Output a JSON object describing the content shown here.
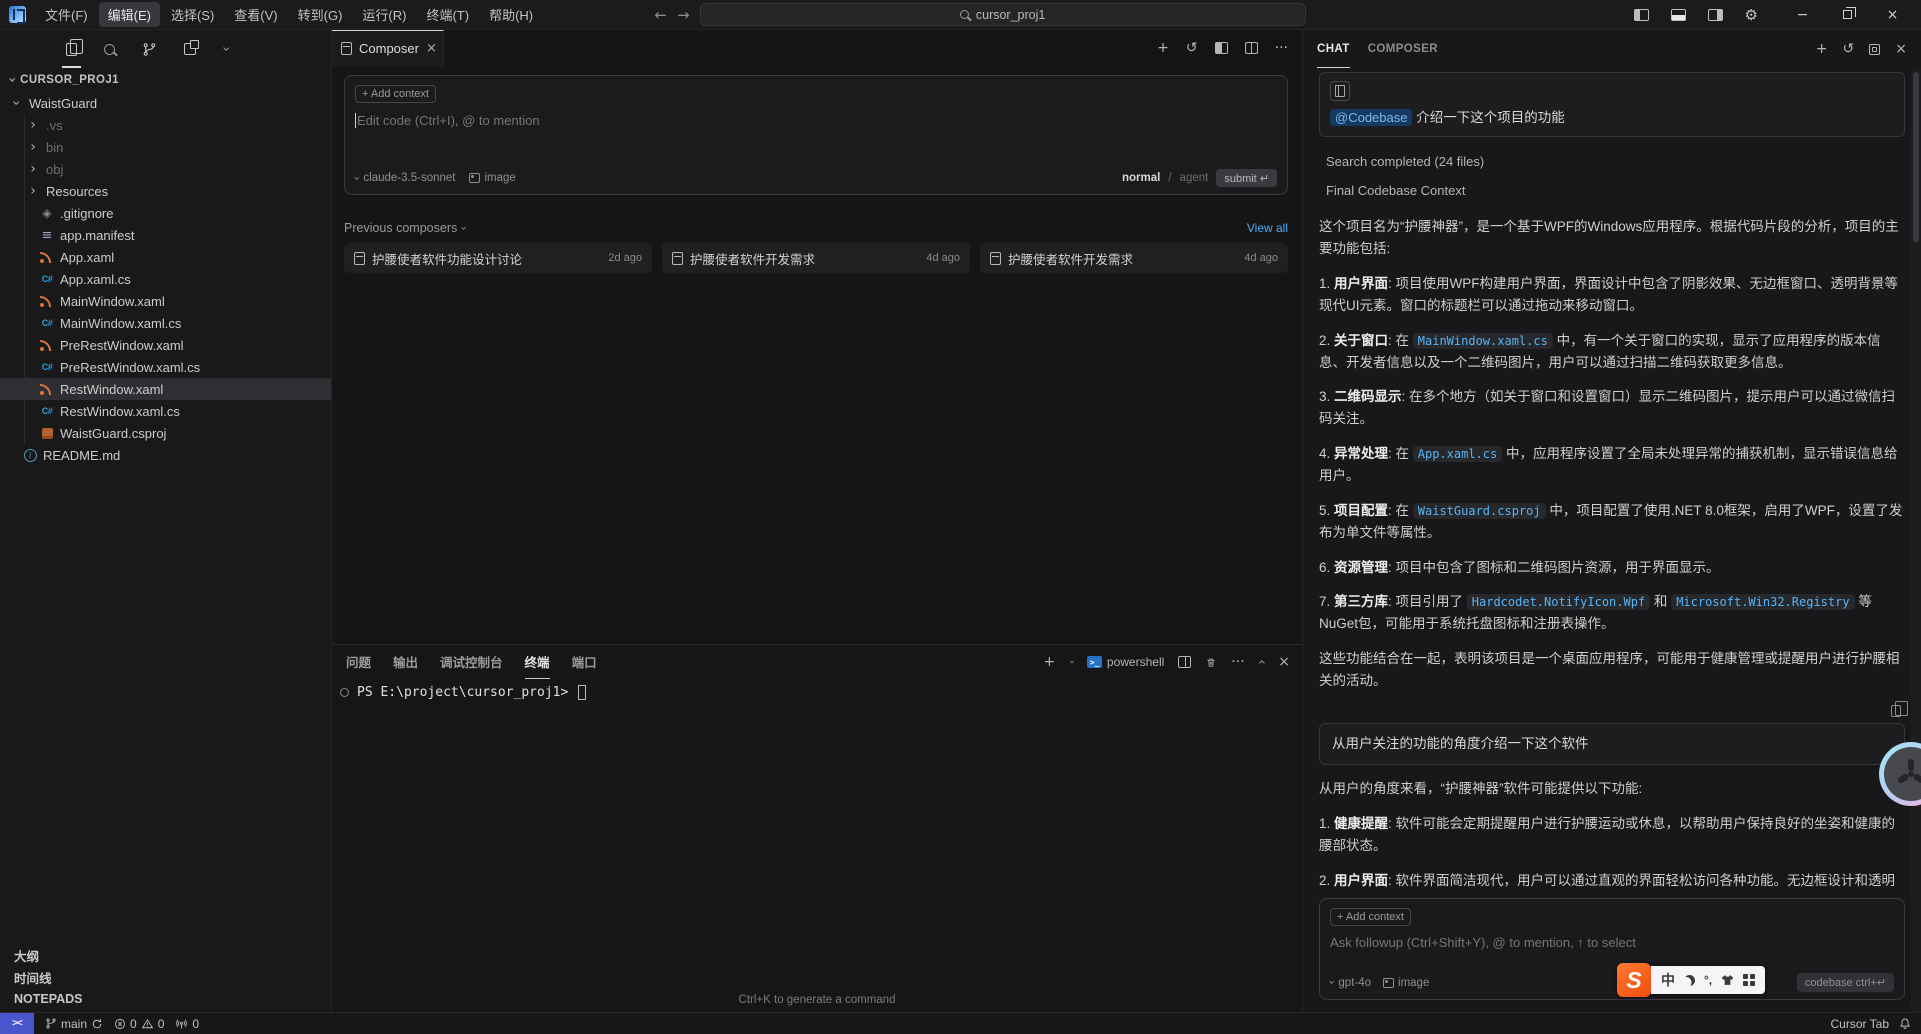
{
  "colors": {
    "accent_blue": "#4daafc",
    "code_blue": "#58b3f5",
    "xaml_orange": "#d8763a",
    "csharp_blue": "#2d9fd8",
    "remote_button_blue": "#4a56cc",
    "ime_orange": "#ef4d0c",
    "codebase_chip_bg": "#143a61"
  },
  "icons": {
    "plus": "+",
    "close": "×",
    "dots": "···",
    "history": "↺",
    "chevron": "›",
    "back": "←",
    "forward": "→",
    "gear": "⚙",
    "minimize": "−",
    "remote": "><",
    "model_chevron": "∨"
  },
  "titlebar": {
    "menus": [
      {
        "label": "文件(F)",
        "cls": ""
      },
      {
        "label": "编辑(E)",
        "cls": "active"
      },
      {
        "label": "选择(S)",
        "cls": ""
      },
      {
        "label": "查看(V)",
        "cls": ""
      },
      {
        "label": "转到(G)",
        "cls": ""
      },
      {
        "label": "运行(R)",
        "cls": ""
      },
      {
        "label": "终端(T)",
        "cls": ""
      },
      {
        "label": "帮助(H)",
        "cls": ""
      }
    ],
    "search_value": "cursor_proj1"
  },
  "sidebar": {
    "project": "CURSOR_PROJ1",
    "tree": [
      {
        "label": "WaistGuard",
        "icon": "ic-chev ic-down",
        "cls": "ind1 haschev"
      },
      {
        "label": ".vs",
        "icon": "ic-chev",
        "cls": "ind2 haschev dim"
      },
      {
        "label": "bin",
        "icon": "ic-chev",
        "cls": "ind2 haschev dim"
      },
      {
        "label": "obj",
        "icon": "ic-chev",
        "cls": "ind2 haschev dim"
      },
      {
        "label": "Resources",
        "icon": "ic-chev",
        "cls": "ind2 haschev"
      },
      {
        "label": ".gitignore",
        "icon": "ic-gitignore",
        "cls": "ind2"
      },
      {
        "label": "app.manifest",
        "icon": "ic-manifest",
        "cls": "ind2"
      },
      {
        "label": "App.xaml",
        "icon": "ic-xaml",
        "cls": "ind2"
      },
      {
        "label": "App.xaml.cs",
        "icon": "ic-cs",
        "cls": "ind2"
      },
      {
        "label": "MainWindow.xaml",
        "icon": "ic-xaml",
        "cls": "ind2"
      },
      {
        "label": "MainWindow.xaml.cs",
        "icon": "ic-cs",
        "cls": "ind2"
      },
      {
        "label": "PreRestWindow.xaml",
        "icon": "ic-xaml",
        "cls": "ind2"
      },
      {
        "label": "PreRestWindow.xaml.cs",
        "icon": "ic-cs",
        "cls": "ind2"
      },
      {
        "label": "RestWindow.xaml",
        "icon": "ic-xaml",
        "cls": "ind2 selected"
      },
      {
        "label": "RestWindow.xaml.cs",
        "icon": "ic-cs",
        "cls": "ind2"
      },
      {
        "label": "WaistGuard.csproj",
        "icon": "ic-csproj",
        "cls": "ind2"
      },
      {
        "label": "README.md",
        "icon": "ic-readme",
        "cls": "ind1"
      }
    ],
    "bottom_sections": [
      {
        "label": "大纲"
      },
      {
        "label": "时间线"
      },
      {
        "label": "NOTEPADS"
      }
    ]
  },
  "editor": {
    "tab_title": "Composer",
    "composer": {
      "add_context": "+ Add context",
      "placeholder": "Edit code (Ctrl+I), @ to mention",
      "model": "claude-3.5-sonnet",
      "image_label": "image",
      "mode_normal": "normal",
      "mode_separator": "/",
      "mode_agent": "agent",
      "submit_label": "submit ↵"
    },
    "previous": {
      "header": "Previous composers",
      "view_all": "View all",
      "cards": [
        {
          "title": "护腰使者软件功能设计讨论",
          "age": "2d ago"
        },
        {
          "title": "护腰使者软件开发需求",
          "age": "4d ago"
        },
        {
          "title": "护腰使者软件开发需求",
          "age": "4d ago"
        }
      ]
    }
  },
  "terminal": {
    "tabs": [
      {
        "label": "问题",
        "cls": ""
      },
      {
        "label": "输出",
        "cls": ""
      },
      {
        "label": "调试控制台",
        "cls": ""
      },
      {
        "label": "终端",
        "cls": "active"
      },
      {
        "label": "端口",
        "cls": ""
      }
    ],
    "shell_label": "powershell",
    "prompt": "PS E:\\project\\cursor_proj1>",
    "hint": "Ctrl+K to generate a command"
  },
  "chat": {
    "tabs": [
      {
        "label": "CHAT",
        "cls": "active"
      },
      {
        "label": "COMPOSER",
        "cls": ""
      }
    ],
    "user1_chip": "@Codebase",
    "user1_text": " 介绍一下这个项目的功能",
    "collapsibles": [
      {
        "label": "Search completed (24 files)"
      },
      {
        "label": "Final Codebase Context"
      }
    ],
    "response1": [
      {
        "seg": [
          {
            "t": "t",
            "s": "这个项目名为“护腰神器”，是一个基于WPF的Windows应用程序。根据代码片段的分析，项目的主要功能包括:"
          }
        ]
      },
      {
        "seg": [
          {
            "t": "t",
            "s": "1. "
          },
          {
            "t": "b",
            "s": "用户界面"
          },
          {
            "t": "t",
            "s": ": 项目使用WPF构建用户界面，界面设计中包含了阴影效果、无边框窗口、透明背景等现代UI元素。窗口的标题栏可以通过拖动来移动窗口。"
          }
        ]
      },
      {
        "seg": [
          {
            "t": "t",
            "s": "2. "
          },
          {
            "t": "b",
            "s": "关于窗口"
          },
          {
            "t": "t",
            "s": ": 在 "
          },
          {
            "t": "code",
            "s": "MainWindow.xaml.cs"
          },
          {
            "t": "t",
            "s": " 中，有一个关于窗口的实现，显示了应用程序的版本信息、开发者信息以及一个二维码图片，用户可以通过扫描二维码获取更多信息。"
          }
        ]
      },
      {
        "seg": [
          {
            "t": "t",
            "s": "3. "
          },
          {
            "t": "b",
            "s": "二维码显示"
          },
          {
            "t": "t",
            "s": ": 在多个地方（如关于窗口和设置窗口）显示二维码图片，提示用户可以通过微信扫码关注。"
          }
        ]
      },
      {
        "seg": [
          {
            "t": "t",
            "s": "4. "
          },
          {
            "t": "b",
            "s": "异常处理"
          },
          {
            "t": "t",
            "s": ": 在 "
          },
          {
            "t": "code",
            "s": "App.xaml.cs"
          },
          {
            "t": "t",
            "s": " 中，应用程序设置了全局未处理异常的捕获机制，显示错误信息给用户。"
          }
        ]
      },
      {
        "seg": [
          {
            "t": "t",
            "s": "5. "
          },
          {
            "t": "b",
            "s": "项目配置"
          },
          {
            "t": "t",
            "s": ": 在 "
          },
          {
            "t": "code",
            "s": "WaistGuard.csproj"
          },
          {
            "t": "t",
            "s": " 中，项目配置了使用.NET 8.0框架，启用了WPF，设置了发布为单文件等属性。"
          }
        ]
      },
      {
        "seg": [
          {
            "t": "t",
            "s": "6. "
          },
          {
            "t": "b",
            "s": "资源管理"
          },
          {
            "t": "t",
            "s": ": 项目中包含了图标和二维码图片资源，用于界面显示。"
          }
        ]
      },
      {
        "seg": [
          {
            "t": "t",
            "s": "7. "
          },
          {
            "t": "b",
            "s": "第三方库"
          },
          {
            "t": "t",
            "s": ": 项目引用了 "
          },
          {
            "t": "code",
            "s": "Hardcodet.NotifyIcon.Wpf"
          },
          {
            "t": "t",
            "s": " 和 "
          },
          {
            "t": "code",
            "s": "Microsoft.Win32.Registry"
          },
          {
            "t": "t",
            "s": " 等NuGet包，可能用于系统托盘图标和注册表操作。"
          }
        ]
      },
      {
        "seg": [
          {
            "t": "t",
            "s": "这些功能结合在一起，表明该项目是一个桌面应用程序，可能用于健康管理或提醒用户进行护腰相关的活动。"
          }
        ]
      }
    ],
    "user2_text": "从用户关注的功能的角度介绍一下这个软件",
    "response2": [
      {
        "seg": [
          {
            "t": "t",
            "s": "从用户的角度来看，“护腰神器”软件可能提供以下功能:"
          }
        ]
      },
      {
        "seg": [
          {
            "t": "t",
            "s": "1. "
          },
          {
            "t": "b",
            "s": "健康提醒"
          },
          {
            "t": "t",
            "s": ": 软件可能会定期提醒用户进行护腰运动或休息，以帮助用户保持良好的坐姿和健康的腰部状态。"
          }
        ]
      },
      {
        "seg": [
          {
            "t": "t",
            "s": "2. "
          },
          {
            "t": "b",
            "s": "用户界面"
          },
          {
            "t": "t",
            "s": ": 软件界面简洁现代，用户可以通过直观的界面轻松访问各种功能。无边框设计和透明背景使得软件看起来更具现代感。"
          }
        ]
      }
    ],
    "input": {
      "add_context": "+ Add context",
      "placeholder": "Ask followup (Ctrl+Shift+Y), @ to mention, ↑ to select",
      "model": "gpt-4o",
      "image_label": "image",
      "codebase_label": "codebase ctrl+↵"
    }
  },
  "statusbar": {
    "branch": "main",
    "errors": "0",
    "warnings": "0",
    "ports": "0",
    "right_label": "Cursor Tab"
  },
  "ime": {
    "logo": "S",
    "lang": "中",
    "punct": "°,"
  }
}
